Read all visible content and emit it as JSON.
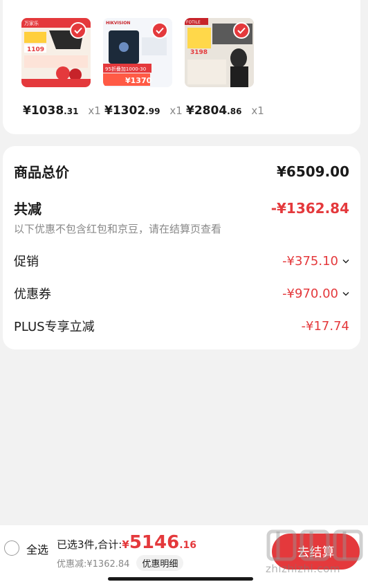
{
  "products": [
    {
      "name": "range-hood",
      "price_int": "¥1038",
      "price_frac": ".31",
      "qty": "x1"
    },
    {
      "name": "smart-lock",
      "price_int": "¥1302",
      "price_frac": ".99",
      "qty": "x1"
    },
    {
      "name": "stove-set",
      "price_int": "¥2804",
      "price_frac": ".86",
      "qty": "x1"
    }
  ],
  "thumb_texts": {
    "p1_brand": "万家乐",
    "p1_price": "1109",
    "p2_brand": "HIKVISION",
    "p2_promo": "95折叠加1000-30",
    "p2_price": "¥1370",
    "p3_brand": "FOTILE",
    "p3_price": "3198"
  },
  "summary": {
    "total_label": "商品总价",
    "total_value": "¥6509.00",
    "reduce_label": "共减",
    "reduce_value": "-¥1362.84",
    "note": "以下优惠不包含红包和京豆，请在结算页查看",
    "promo_label": "促销",
    "promo_value": "-¥375.10",
    "coupon_label": "优惠券",
    "coupon_value": "-¥970.00",
    "plus_label": "PLUS专享立减",
    "plus_value": "-¥17.74"
  },
  "bottom": {
    "select_all": "全选",
    "selected_text": "已选3件,合计:",
    "currency": "¥",
    "total_int": "5146",
    "total_frac": ".16",
    "discount_text": "优惠减:¥1362.84",
    "detail_label": "优惠明细",
    "checkout_label": "去结算"
  },
  "watermark": "zhizhizhi.com",
  "colors": {
    "accent": "#e4393c",
    "background": "#f2f2f2",
    "card": "#ffffff"
  }
}
